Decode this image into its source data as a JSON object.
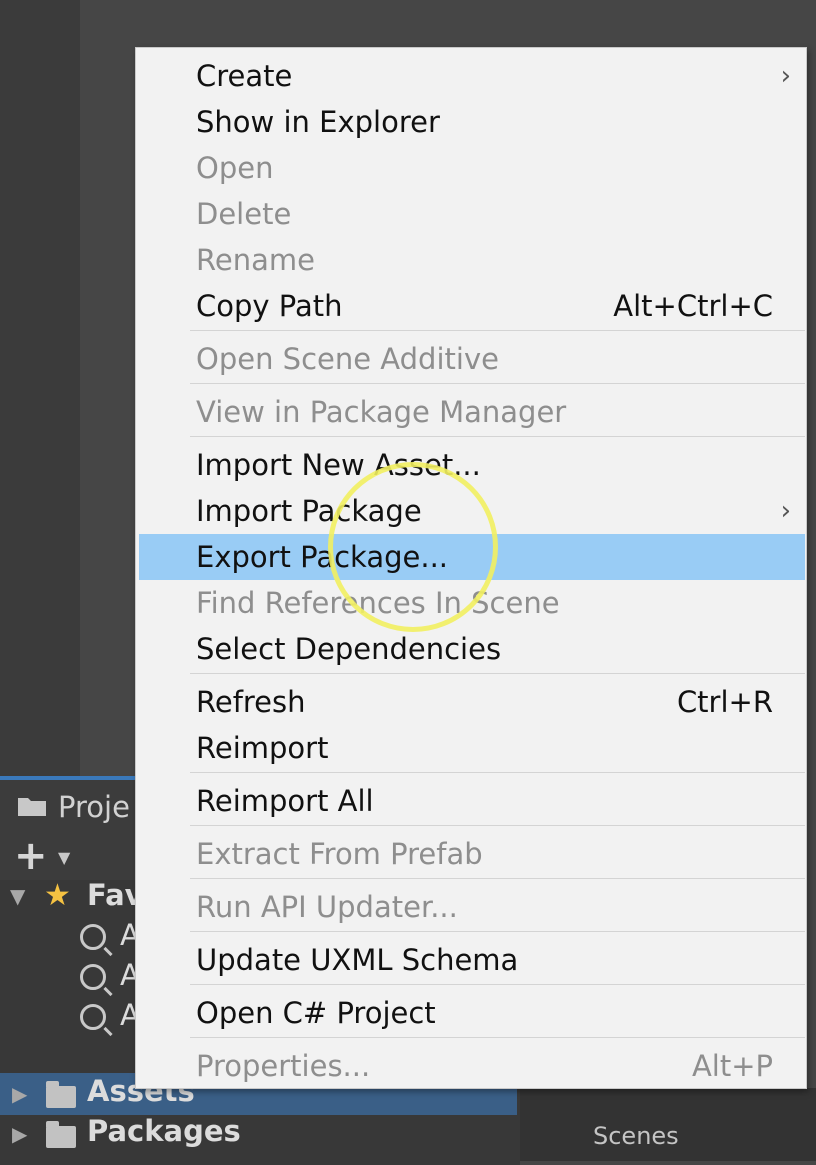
{
  "project_panel": {
    "tab_label": "Proje",
    "favorites_label": "Fav",
    "search_items": [
      "A",
      "A",
      "A"
    ],
    "assets_label": "Assets",
    "packages_label": "Packages"
  },
  "scenes_panel": {
    "label": "Scenes"
  },
  "context_menu": {
    "highlighted": "Export Package...",
    "items": [
      {
        "label": "Create",
        "shortcut": "",
        "submenu": true,
        "enabled": true
      },
      {
        "label": "Show in Explorer",
        "shortcut": "",
        "submenu": false,
        "enabled": true
      },
      {
        "label": "Open",
        "shortcut": "",
        "submenu": false,
        "enabled": false
      },
      {
        "label": "Delete",
        "shortcut": "",
        "submenu": false,
        "enabled": false
      },
      {
        "label": "Rename",
        "shortcut": "",
        "submenu": false,
        "enabled": false
      },
      {
        "label": "Copy Path",
        "shortcut": "Alt+Ctrl+C",
        "submenu": false,
        "enabled": true
      },
      {
        "label": "Open Scene Additive",
        "shortcut": "",
        "submenu": false,
        "enabled": false
      },
      {
        "label": "View in Package Manager",
        "shortcut": "",
        "submenu": false,
        "enabled": false
      },
      {
        "label": "Import New Asset...",
        "shortcut": "",
        "submenu": false,
        "enabled": true
      },
      {
        "label": "Import Package",
        "shortcut": "",
        "submenu": true,
        "enabled": true
      },
      {
        "label": "Export Package...",
        "shortcut": "",
        "submenu": false,
        "enabled": true
      },
      {
        "label": "Find References In Scene",
        "shortcut": "",
        "submenu": false,
        "enabled": false
      },
      {
        "label": "Select Dependencies",
        "shortcut": "",
        "submenu": false,
        "enabled": true
      },
      {
        "label": "Refresh",
        "shortcut": "Ctrl+R",
        "submenu": false,
        "enabled": true
      },
      {
        "label": "Reimport",
        "shortcut": "",
        "submenu": false,
        "enabled": true
      },
      {
        "label": "Reimport All",
        "shortcut": "",
        "submenu": false,
        "enabled": true
      },
      {
        "label": "Extract From Prefab",
        "shortcut": "",
        "submenu": false,
        "enabled": false
      },
      {
        "label": "Run API Updater...",
        "shortcut": "",
        "submenu": false,
        "enabled": false
      },
      {
        "label": "Update UXML Schema",
        "shortcut": "",
        "submenu": false,
        "enabled": true
      },
      {
        "label": "Open C# Project",
        "shortcut": "",
        "submenu": false,
        "enabled": true
      },
      {
        "label": "Properties...",
        "shortcut": "Alt+P",
        "submenu": false,
        "enabled": false
      }
    ]
  },
  "colors": {
    "menu_bg": "#f2f2f2",
    "highlight": "#99ccf5",
    "disabled_text": "#8e8e8e",
    "selection_row": "#3a5f87"
  }
}
